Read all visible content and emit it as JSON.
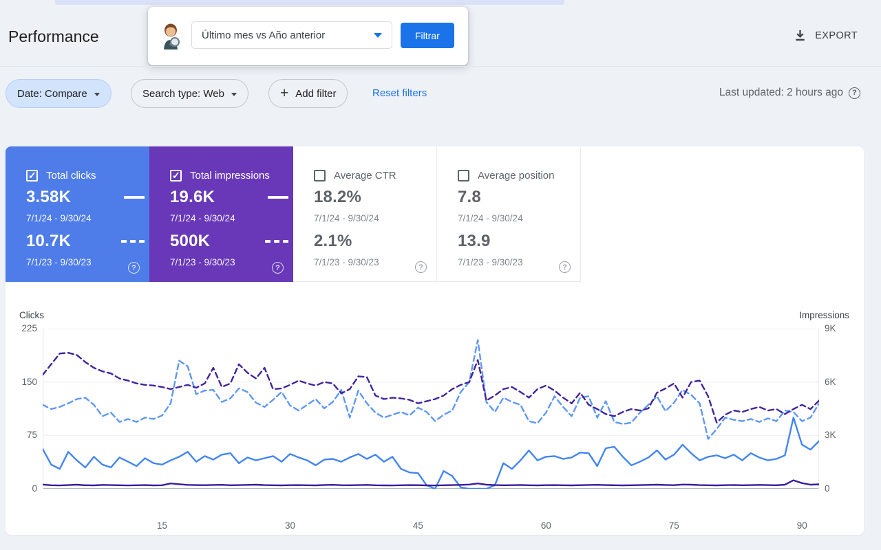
{
  "header": {
    "title": "Performance",
    "export_label": "EXPORT"
  },
  "floating_panel": {
    "dropdown_value": "Último mes vs Año anterior",
    "filter_button_label": "Filtrar"
  },
  "filters": {
    "date_chip": "Date: Compare",
    "search_type_chip": "Search type: Web",
    "add_filter_label": "Add filter",
    "plus_glyph": "+",
    "reset_link": "Reset filters",
    "last_updated": "Last updated: 2 hours ago",
    "help_glyph": "?"
  },
  "metric_cards": [
    {
      "label": "Total clicks",
      "checked": true,
      "bg": "#4e7ce8",
      "value_current": "3.58K",
      "range_current": "7/1/24 - 9/30/24",
      "value_previous": "10.7K",
      "range_previous": "7/1/23 - 9/30/23",
      "help_glyph": "?"
    },
    {
      "label": "Total impressions",
      "checked": true,
      "bg": "#6838b8",
      "value_current": "19.6K",
      "range_current": "7/1/24 - 9/30/24",
      "value_previous": "500K",
      "range_previous": "7/1/23 - 9/30/23",
      "help_glyph": "?"
    },
    {
      "label": "Average CTR",
      "checked": false,
      "bg": "#ffffff",
      "value_current": "18.2%",
      "range_current": "7/1/24 - 9/30/24",
      "value_previous": "2.1%",
      "range_previous": "7/1/23 - 9/30/23",
      "help_glyph": "?"
    },
    {
      "label": "Average position",
      "checked": false,
      "bg": "#ffffff",
      "value_current": "7.8",
      "range_current": "7/1/24 - 9/30/24",
      "value_previous": "13.9",
      "range_previous": "7/1/23 - 9/30/23",
      "help_glyph": "?"
    }
  ],
  "chart_data": {
    "type": "line",
    "x_axis": {
      "days": 92,
      "ticks": [
        15,
        30,
        45,
        60,
        75,
        90
      ]
    },
    "left_axis": {
      "title": "Clicks",
      "ticks": [
        0,
        75,
        150,
        225
      ],
      "max": 225
    },
    "right_axis": {
      "title": "Impressions",
      "tick_values": [
        0,
        3000,
        6000,
        9000
      ],
      "tick_labels": [
        "0",
        "3K",
        "6K",
        "9K"
      ],
      "max": 9000
    },
    "grid": true,
    "series": [
      {
        "id": "clicks-current",
        "name": "Clicks 7/1/24 - 9/30/24",
        "axis": "left",
        "style": "solid",
        "color": "#4285f4",
        "values": [
          56,
          34,
          28,
          52,
          40,
          30,
          45,
          34,
          30,
          44,
          38,
          32,
          43,
          36,
          34,
          40,
          45,
          52,
          38,
          46,
          41,
          48,
          50,
          36,
          44,
          40,
          43,
          46,
          38,
          49,
          44,
          40,
          33,
          41,
          42,
          38,
          44,
          49,
          42,
          48,
          38,
          45,
          28,
          23,
          22,
          5,
          0,
          25,
          18,
          2,
          0,
          0,
          0,
          5,
          36,
          28,
          40,
          54,
          40,
          45,
          46,
          42,
          44,
          51,
          50,
          32,
          57,
          59,
          45,
          33,
          38,
          44,
          54,
          41,
          48,
          62,
          50,
          40,
          45,
          47,
          43,
          48,
          40,
          50,
          44,
          40,
          42,
          47,
          100,
          62,
          55,
          67
        ]
      },
      {
        "id": "clicks-previous",
        "name": "Clicks 7/1/23 - 9/30/23",
        "axis": "left",
        "style": "dashed",
        "color": "#5e97f6",
        "values": [
          118,
          112,
          115,
          120,
          126,
          128,
          118,
          102,
          107,
          94,
          98,
          94,
          100,
          98,
          103,
          120,
          180,
          172,
          133,
          138,
          139,
          122,
          127,
          141,
          136,
          121,
          115,
          125,
          136,
          117,
          110,
          118,
          126,
          113,
          122,
          139,
          100,
          138,
          120,
          107,
          100,
          104,
          108,
          103,
          114,
          108,
          95,
          104,
          110,
          136,
          150,
          209,
          122,
          108,
          128,
          122,
          118,
          95,
          92,
          107,
          130,
          115,
          102,
          128,
          130,
          100,
          123,
          94,
          91,
          93,
          107,
          118,
          130,
          109,
          121,
          139,
          132,
          120,
          70,
          84,
          100,
          97,
          95,
          98,
          94,
          99,
          95,
          110,
          108,
          95,
          100,
          120
        ]
      },
      {
        "id": "impressions-current",
        "name": "Impressions 7/1/24 - 9/30/24",
        "axis": "right",
        "style": "solid",
        "color": "#3a1d9a",
        "values": [
          240,
          200,
          190,
          210,
          230,
          200,
          195,
          220,
          210,
          200,
          190,
          200,
          210,
          195,
          200,
          300,
          260,
          220,
          210,
          205,
          215,
          225,
          200,
          210,
          220,
          230,
          210,
          200,
          195,
          205,
          210,
          200,
          195,
          215,
          225,
          205,
          200,
          210,
          220,
          200,
          195,
          190,
          200,
          210,
          205,
          195,
          190,
          200,
          210,
          220,
          240,
          300,
          230,
          210,
          200,
          205,
          215,
          200,
          195,
          205,
          210,
          200,
          195,
          205,
          215,
          225,
          210,
          200,
          195,
          200,
          210,
          220,
          230,
          215,
          205,
          240,
          230,
          210,
          200,
          195,
          205,
          215,
          200,
          210,
          220,
          210,
          200,
          230,
          480,
          320,
          230,
          250
        ]
      },
      {
        "id": "impressions-previous",
        "name": "Impressions 7/1/23 - 9/30/23",
        "axis": "right",
        "style": "dashed",
        "color": "#41249c",
        "values": [
          6400,
          7000,
          7600,
          7640,
          7520,
          7120,
          6800,
          6600,
          6480,
          6200,
          6080,
          5920,
          5840,
          5800,
          5720,
          5600,
          5720,
          5840,
          5680,
          5920,
          6800,
          5720,
          5920,
          7000,
          6520,
          6200,
          6800,
          5600,
          5640,
          5840,
          6080,
          5920,
          5800,
          6000,
          5920,
          5360,
          5600,
          6320,
          6280,
          5240,
          5040,
          5120,
          5080,
          5000,
          4800,
          4920,
          5040,
          5240,
          5600,
          5840,
          6000,
          7240,
          4960,
          5240,
          5600,
          5720,
          5440,
          5120,
          5600,
          5800,
          5520,
          5120,
          4800,
          5400,
          4720,
          4480,
          4200,
          4080,
          4320,
          4480,
          4400,
          4520,
          5400,
          5640,
          5920,
          5120,
          6000,
          6080,
          5200,
          3720,
          4160,
          4400,
          4320,
          4480,
          4600,
          4400,
          4480,
          4200,
          4480,
          4720,
          4480,
          4960
        ]
      }
    ]
  }
}
